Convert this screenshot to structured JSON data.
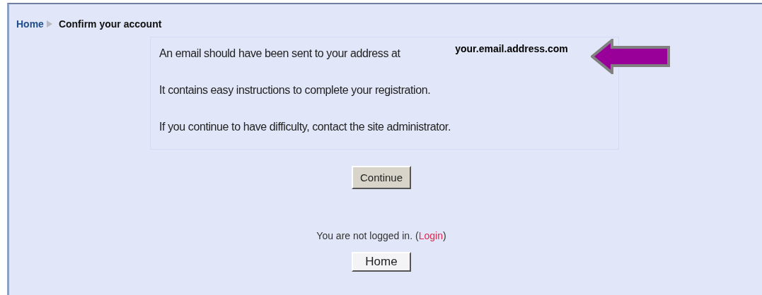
{
  "breadcrumb": {
    "home": "Home",
    "current": "Confirm your account"
  },
  "message": [
    "An email should have been sent to your address at",
    "It contains easy instructions to complete your registration.",
    "If you continue to have difficulty, contact the site administrator."
  ],
  "annotation": {
    "label": "your.email.address.com"
  },
  "continue_button": "Continue",
  "login_info": {
    "text": "You are not logged in.",
    "open": "(",
    "link": "Login",
    "close": ")"
  },
  "home_button": "Home"
}
